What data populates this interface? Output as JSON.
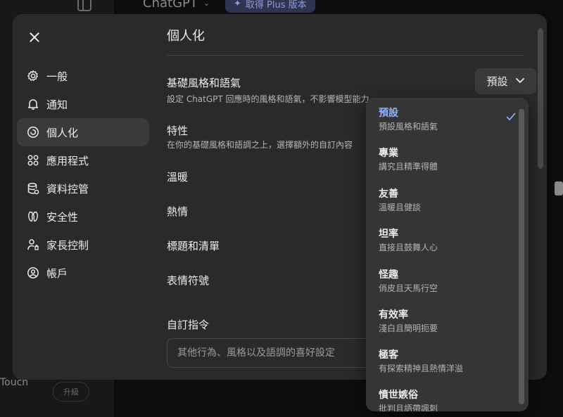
{
  "background": {
    "app_title": "ChatGPT",
    "plus_button": "取得 Plus 版本",
    "bottom_label": "Touch",
    "upgrade_label": "升級"
  },
  "nav": {
    "items": [
      {
        "label": "一般",
        "icon": "gear-icon"
      },
      {
        "label": "通知",
        "icon": "bell-icon"
      },
      {
        "label": "個人化",
        "icon": "personalization-icon"
      },
      {
        "label": "應用程式",
        "icon": "apps-grid-icon"
      },
      {
        "label": "資料控管",
        "icon": "database-icon"
      },
      {
        "label": "安全性",
        "icon": "security-icon"
      },
      {
        "label": "家長控制",
        "icon": "parent-user-icon"
      },
      {
        "label": "帳戶",
        "icon": "account-icon"
      }
    ],
    "active_index": 2
  },
  "main": {
    "title": "個人化",
    "base_style": {
      "label": "基礎風格和語氣",
      "desc": "設定 ChatGPT 回應時的風格和語氣，不影響模型能力。",
      "select_value": "預設"
    },
    "traits": {
      "label": "特性",
      "desc": "在你的基礎風格和語調之上，選擇額外的自訂內容"
    },
    "toggles": [
      "溫暖",
      "熱情",
      "標題和清單",
      "表情符號"
    ],
    "custom_instructions": {
      "label": "自訂指令",
      "placeholder": "其他行為、風格以及語調的喜好設定"
    }
  },
  "dropdown": {
    "options": [
      {
        "title": "預設",
        "desc": "預設風格和語氣",
        "selected": true
      },
      {
        "title": "專業",
        "desc": "講究且精準得體",
        "selected": false
      },
      {
        "title": "友善",
        "desc": "溫暖且健談",
        "selected": false
      },
      {
        "title": "坦率",
        "desc": "直接且鼓舞人心",
        "selected": false
      },
      {
        "title": "怪趣",
        "desc": "俏皮且天馬行空",
        "selected": false
      },
      {
        "title": "有效率",
        "desc": "淺白且簡明扼要",
        "selected": false
      },
      {
        "title": "極客",
        "desc": "有探索精神且熱情洋溢",
        "selected": false
      },
      {
        "title": "憤世嫉俗",
        "desc": "批判且語帶諷刺",
        "selected": false
      }
    ]
  },
  "colors": {
    "modal_bg": "#2a2a2a",
    "active_nav": "#3a3a3a",
    "dropdown_bg": "#353535",
    "accent": "#8fb3ff"
  }
}
